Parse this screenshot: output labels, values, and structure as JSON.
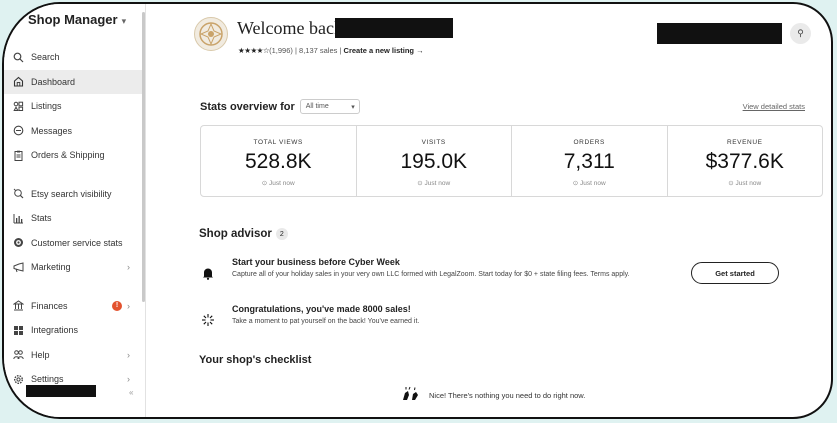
{
  "sidebar": {
    "shop_name": "Shop Manager",
    "shop_chevron": "▾",
    "items": [
      {
        "label": "Search",
        "icon": "search-icon"
      },
      {
        "label": "Dashboard",
        "icon": "home-icon",
        "active": true
      },
      {
        "label": "Listings",
        "icon": "listings-icon"
      },
      {
        "label": "Messages",
        "icon": "message-icon"
      },
      {
        "label": "Orders & Shipping",
        "icon": "clipboard-icon"
      },
      {
        "label": "Etsy search visibility",
        "icon": "search-visibility-icon"
      },
      {
        "label": "Stats",
        "icon": "bar-chart-icon"
      },
      {
        "label": "Customer service stats",
        "icon": "target-icon"
      },
      {
        "label": "Marketing",
        "icon": "megaphone-icon",
        "chevron": "›"
      },
      {
        "label": "Finances",
        "icon": "bank-icon",
        "badge": "!",
        "chevron": "›"
      },
      {
        "label": "Integrations",
        "icon": "grid-icon"
      },
      {
        "label": "Help",
        "icon": "people-icon",
        "chevron": "›"
      },
      {
        "label": "Settings",
        "icon": "gear-icon",
        "chevron": "›"
      }
    ],
    "collapse_label": "«"
  },
  "header": {
    "welcome": "Welcome back,",
    "stars": "★★★★☆",
    "reviews": "(1,996)",
    "sales": "8,137 sales",
    "separator": "|",
    "create_listing": "Create a new listing",
    "create_arrow": "→",
    "link_icon_glyph": "⚲"
  },
  "stats": {
    "label": "Stats overview for",
    "range": "All time",
    "range_chevron": "▾",
    "view_detailed": "View detailed stats",
    "cards": [
      {
        "title": "TOTAL VIEWS",
        "value": "528.8K",
        "updated": "Just now"
      },
      {
        "title": "VISITS",
        "value": "195.0K",
        "updated": "Just now"
      },
      {
        "title": "ORDERS",
        "value": "7,311",
        "updated": "Just now"
      },
      {
        "title": "REVENUE",
        "value": "$377.6K",
        "updated": "Just now"
      }
    ],
    "clock_glyph": "⊙"
  },
  "advisor": {
    "title": "Shop advisor",
    "count": "2",
    "items": [
      {
        "heading": "Start your business before Cyber Week",
        "desc": "Capture all of your holiday sales in your very own LLC formed with LegalZoom. Start today for $0 + state filing fees. Terms apply.",
        "icon": "bell-icon"
      },
      {
        "heading": "Congratulations, you've made 8000 sales!",
        "desc": "Take a moment to pat yourself on the back! You've earned it.",
        "icon": "celebration-icon"
      }
    ],
    "cta": "Get started"
  },
  "checklist": {
    "title": "Your shop's checklist",
    "message": "Nice! There's nothing you need to do right now."
  },
  "colors": {
    "accent_orange": "#e3522e",
    "background_teal": "#dff2f1"
  }
}
